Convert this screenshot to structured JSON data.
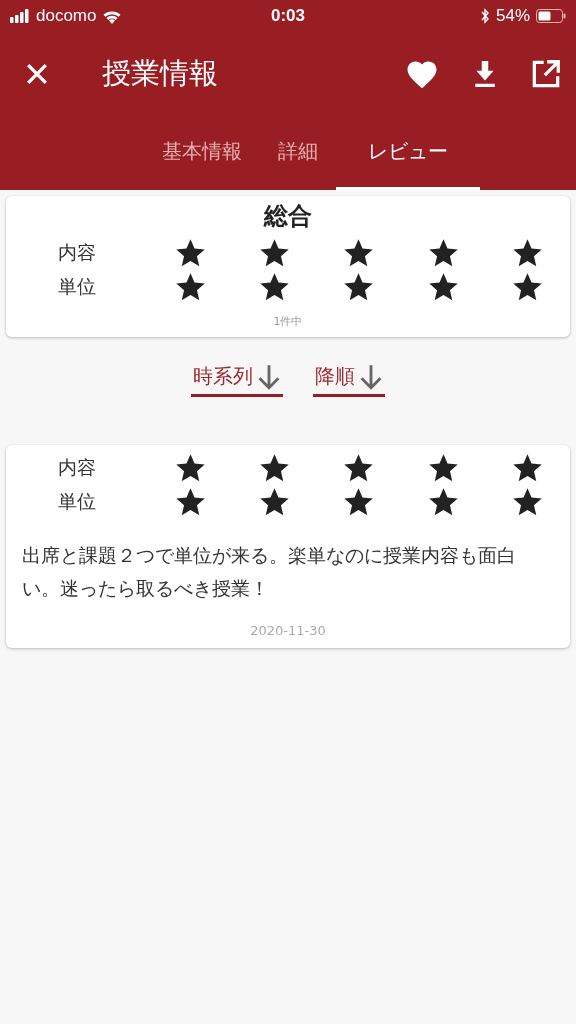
{
  "status_bar": {
    "carrier": "docomo",
    "time": "0:03",
    "battery": "54%"
  },
  "app_bar": {
    "title": "授業情報"
  },
  "tabs": [
    {
      "label": "基本情報",
      "selected": false
    },
    {
      "label": "詳細",
      "selected": false
    },
    {
      "label": "レビュー",
      "selected": true
    }
  ],
  "summary": {
    "title": "総合",
    "ratings": [
      {
        "label": "内容",
        "stars": 5
      },
      {
        "label": "単位",
        "stars": 5
      }
    ],
    "count": "1件中"
  },
  "sort": [
    {
      "label": "時系列"
    },
    {
      "label": "降順"
    }
  ],
  "reviews": [
    {
      "ratings": [
        {
          "label": "内容",
          "stars": 5
        },
        {
          "label": "単位",
          "stars": 5
        }
      ],
      "text": "出席と課題２つで単位が来る。楽単なのに授業内容も面白い。迷ったら取るべき授業！",
      "date": "2020-11-30"
    }
  ]
}
